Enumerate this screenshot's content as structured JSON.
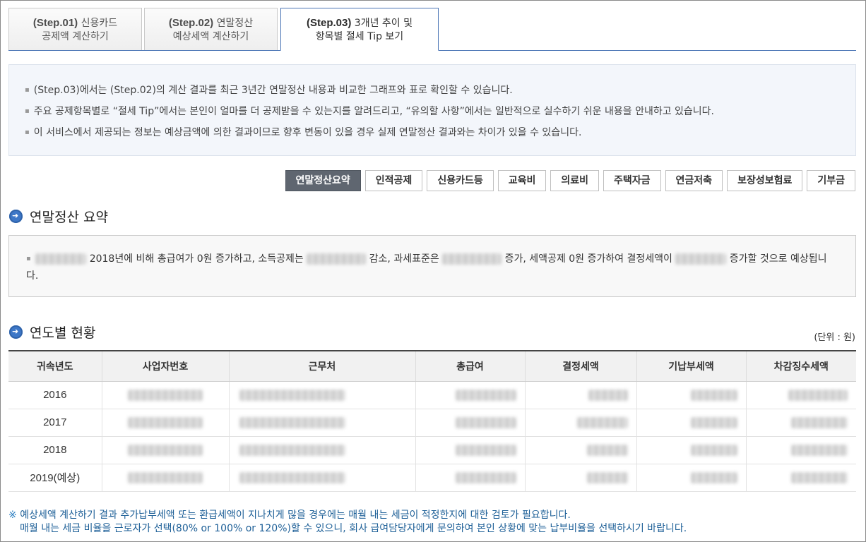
{
  "tabs": [
    {
      "step": "(Step.01)",
      "line1_rest": "신용카드",
      "line2": "공제액 계산하기"
    },
    {
      "step": "(Step.02)",
      "line1_rest": "연말정산",
      "line2": "예상세액 계산하기"
    },
    {
      "step": "(Step.03)",
      "line1_rest": "3개년 추이 및",
      "line2": "항목별 절세 Tip 보기"
    }
  ],
  "notice": [
    "(Step.03)에서는 (Step.02)의 계산 결과를 최근 3년간 연말정산 내용과 비교한 그래프와 표로 확인할 수 있습니다.",
    "주요 공제항목별로 “절세 Tip”에서는 본인이 얼마를 더 공제받을 수 있는지를 알려드리고, “유의할 사항”에서는 일반적으로 실수하기 쉬운 내용을 안내하고 있습니다.",
    "이 서비스에서 제공되는 정보는 예상금액에 의한 결과이므로 향후 변동이 있을 경우 실제 연말정산 결과와는 차이가 있을 수 있습니다."
  ],
  "buttons": [
    "연말정산요약",
    "인적공제",
    "신용카드등",
    "교육비",
    "의료비",
    "주택자금",
    "연금저축",
    "보장성보험료",
    "기부금"
  ],
  "summary_section": {
    "title": "연말정산 요약",
    "seg1": "2018년에 비해 총급여가 0원 증가하고, 소득공제는",
    "seg2": "감소, 과세표준은",
    "seg3": "증가, 세액공제 0원 증가하여 결정세액이",
    "seg4": "증가할 것으로 예상됩니다."
  },
  "yearly_section": {
    "title": "연도별 현황",
    "unit": "(단위 : 원)",
    "columns": [
      "귀속년도",
      "사업자번호",
      "근무처",
      "총급여",
      "결정세액",
      "기납부세액",
      "차감징수세액"
    ],
    "rows": [
      {
        "year": "2016"
      },
      {
        "year": "2017"
      },
      {
        "year": "2018"
      },
      {
        "year": "2019(예상)"
      }
    ]
  },
  "footnote": {
    "mark": "※",
    "line1": "예상세액 계산하기 결과 추가납부세액 또는 환급세액이 지나치게 많을 경우에는 매월 내는 세금이 적정한지에 대한 검토가 필요합니다.",
    "line2": "매월 내는 세금 비율을 근로자가 선택(80% or 100% or 120%)할 수 있으니, 회사 급여담당자에게 문의하여 본인 상황에 맞는 납부비율을 선택하시기 바랍니다."
  }
}
